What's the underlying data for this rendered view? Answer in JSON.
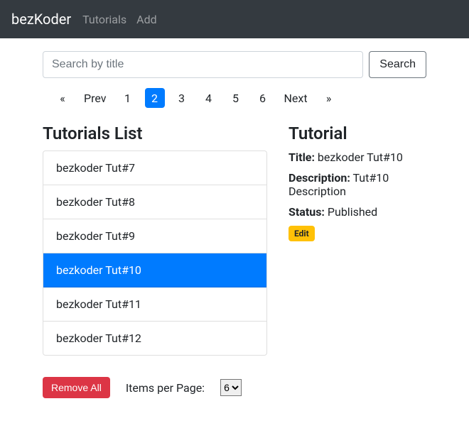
{
  "navbar": {
    "brand": "bezKoder",
    "links": [
      "Tutorials",
      "Add"
    ]
  },
  "search": {
    "placeholder": "Search by title",
    "button": "Search"
  },
  "pagination": {
    "first": "«",
    "prev": "Prev",
    "pages": [
      "1",
      "2",
      "3",
      "4",
      "5",
      "6"
    ],
    "active_index": 1,
    "next": "Next",
    "last": "»"
  },
  "list": {
    "heading": "Tutorials List",
    "items": [
      "bezkoder Tut#7",
      "bezkoder Tut#8",
      "bezkoder Tut#9",
      "bezkoder Tut#10",
      "bezkoder Tut#11",
      "bezkoder Tut#12"
    ],
    "active_index": 3
  },
  "actions": {
    "remove_all": "Remove All",
    "items_per_page_label": "Items per Page:",
    "items_per_page_value": "6"
  },
  "detail": {
    "heading": "Tutorial",
    "title_label": "Title:",
    "title_value": "bezkoder Tut#10",
    "description_label": "Description:",
    "description_value": "Tut#10 Description",
    "status_label": "Status:",
    "status_value": "Published",
    "edit_label": "Edit"
  }
}
